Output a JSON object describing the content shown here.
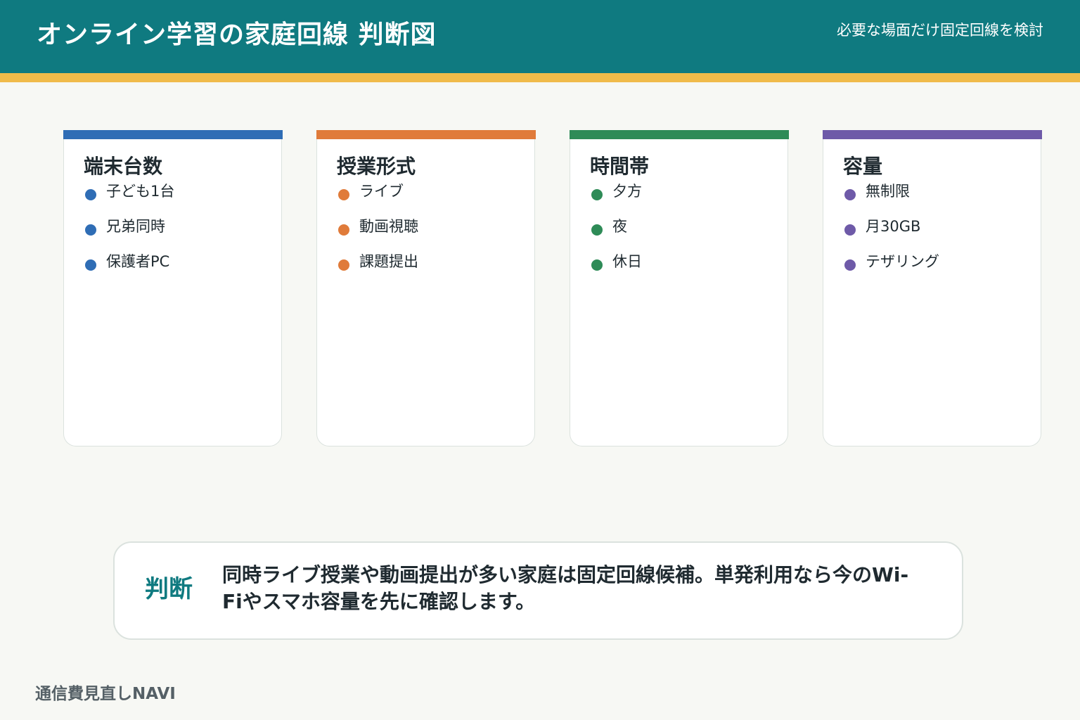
{
  "header": {
    "title": "オンライン学習の家庭回線 判断図",
    "subtitle": "必要な場面だけ固定回線を検討",
    "background_color": "#0f7a80",
    "stripe_color": "#f0bb4a"
  },
  "cards": [
    {
      "title": "端末台数",
      "color": "#2f6db5",
      "items": [
        "子ども1台",
        "兄弟同時",
        "保護者PC"
      ]
    },
    {
      "title": "授業形式",
      "color": "#e07b3a",
      "items": [
        "ライブ",
        "動画視聴",
        "課題提出"
      ]
    },
    {
      "title": "時間帯",
      "color": "#2e8b57",
      "items": [
        "夕方",
        "夜",
        "休日"
      ]
    },
    {
      "title": "容量",
      "color": "#6e5aa8",
      "items": [
        "無制限",
        "月30GB",
        "テザリング"
      ]
    }
  ],
  "judgement": {
    "label": "判断",
    "text": "同時ライブ授業や動画提出が多い家庭は固定回線候補。単発利用なら今のWi-Fiやスマホ容量を先に確認します。"
  },
  "footer": {
    "brand": "通信費見直しNAVI"
  }
}
